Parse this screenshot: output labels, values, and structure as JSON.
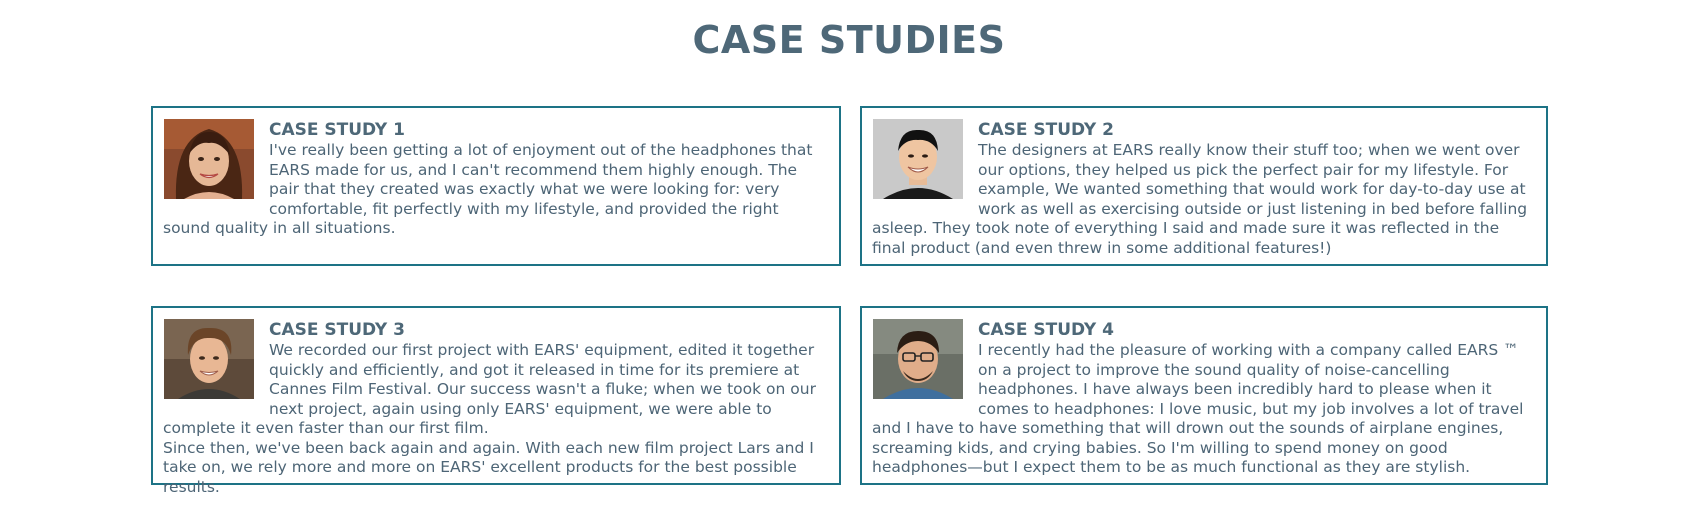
{
  "page": {
    "title": "CASE STUDIES"
  },
  "colors": {
    "heading": "#4e6878",
    "body_text": "#4d6576",
    "card_border": "#1d7386"
  },
  "case_studies": [
    {
      "title": "CASE STUDY 1",
      "avatar": "woman-portrait",
      "paragraphs": [
        "I've really been getting a lot of enjoyment out of the headphones that EARS made for us, and I can't recommend them highly enough. The pair that they created was exactly what we were looking for: very comfortable, fit perfectly with my lifestyle, and provided the right sound quality in all situations."
      ]
    },
    {
      "title": "CASE STUDY 2",
      "avatar": "man-smiling-portrait",
      "paragraphs": [
        "The designers at EARS really know their stuff too; when we went over our options, they helped us pick the perfect pair for my lifestyle. For example, We wanted something that would work for day-to-day use at work as well as exercising outside or just listening in bed before falling asleep. They took note of everything I said and made sure it was reflected in the final product (and even threw in some additional features!)"
      ]
    },
    {
      "title": "CASE STUDY 3",
      "avatar": "young-man-portrait",
      "paragraphs": [
        "We recorded our first project with EARS' equipment, edited it together quickly and efficiently, and got it released in time for its premiere at Cannes Film Festival. Our success wasn't a fluke; when we took on our next project, again using only EARS' equipment, we were able to complete it even faster than our first film.",
        "Since then, we've been back again and again. With each new film project Lars and I take on, we rely more and more on EARS' excellent products for the best possible results."
      ]
    },
    {
      "title": "CASE STUDY 4",
      "avatar": "man-glasses-portrait",
      "paragraphs": [
        "I recently had the pleasure of working with a company called EARS ™ on a project to improve the sound quality of noise-cancelling headphones. I have always been incredibly hard to please when it comes to headphones: I love music, but my job involves a lot of travel and I have to have something that will drown out the sounds of airplane engines, screaming kids, and crying babies. So I'm willing to spend money on good headphones—but I expect them to be as much functional as they are stylish."
      ]
    }
  ]
}
